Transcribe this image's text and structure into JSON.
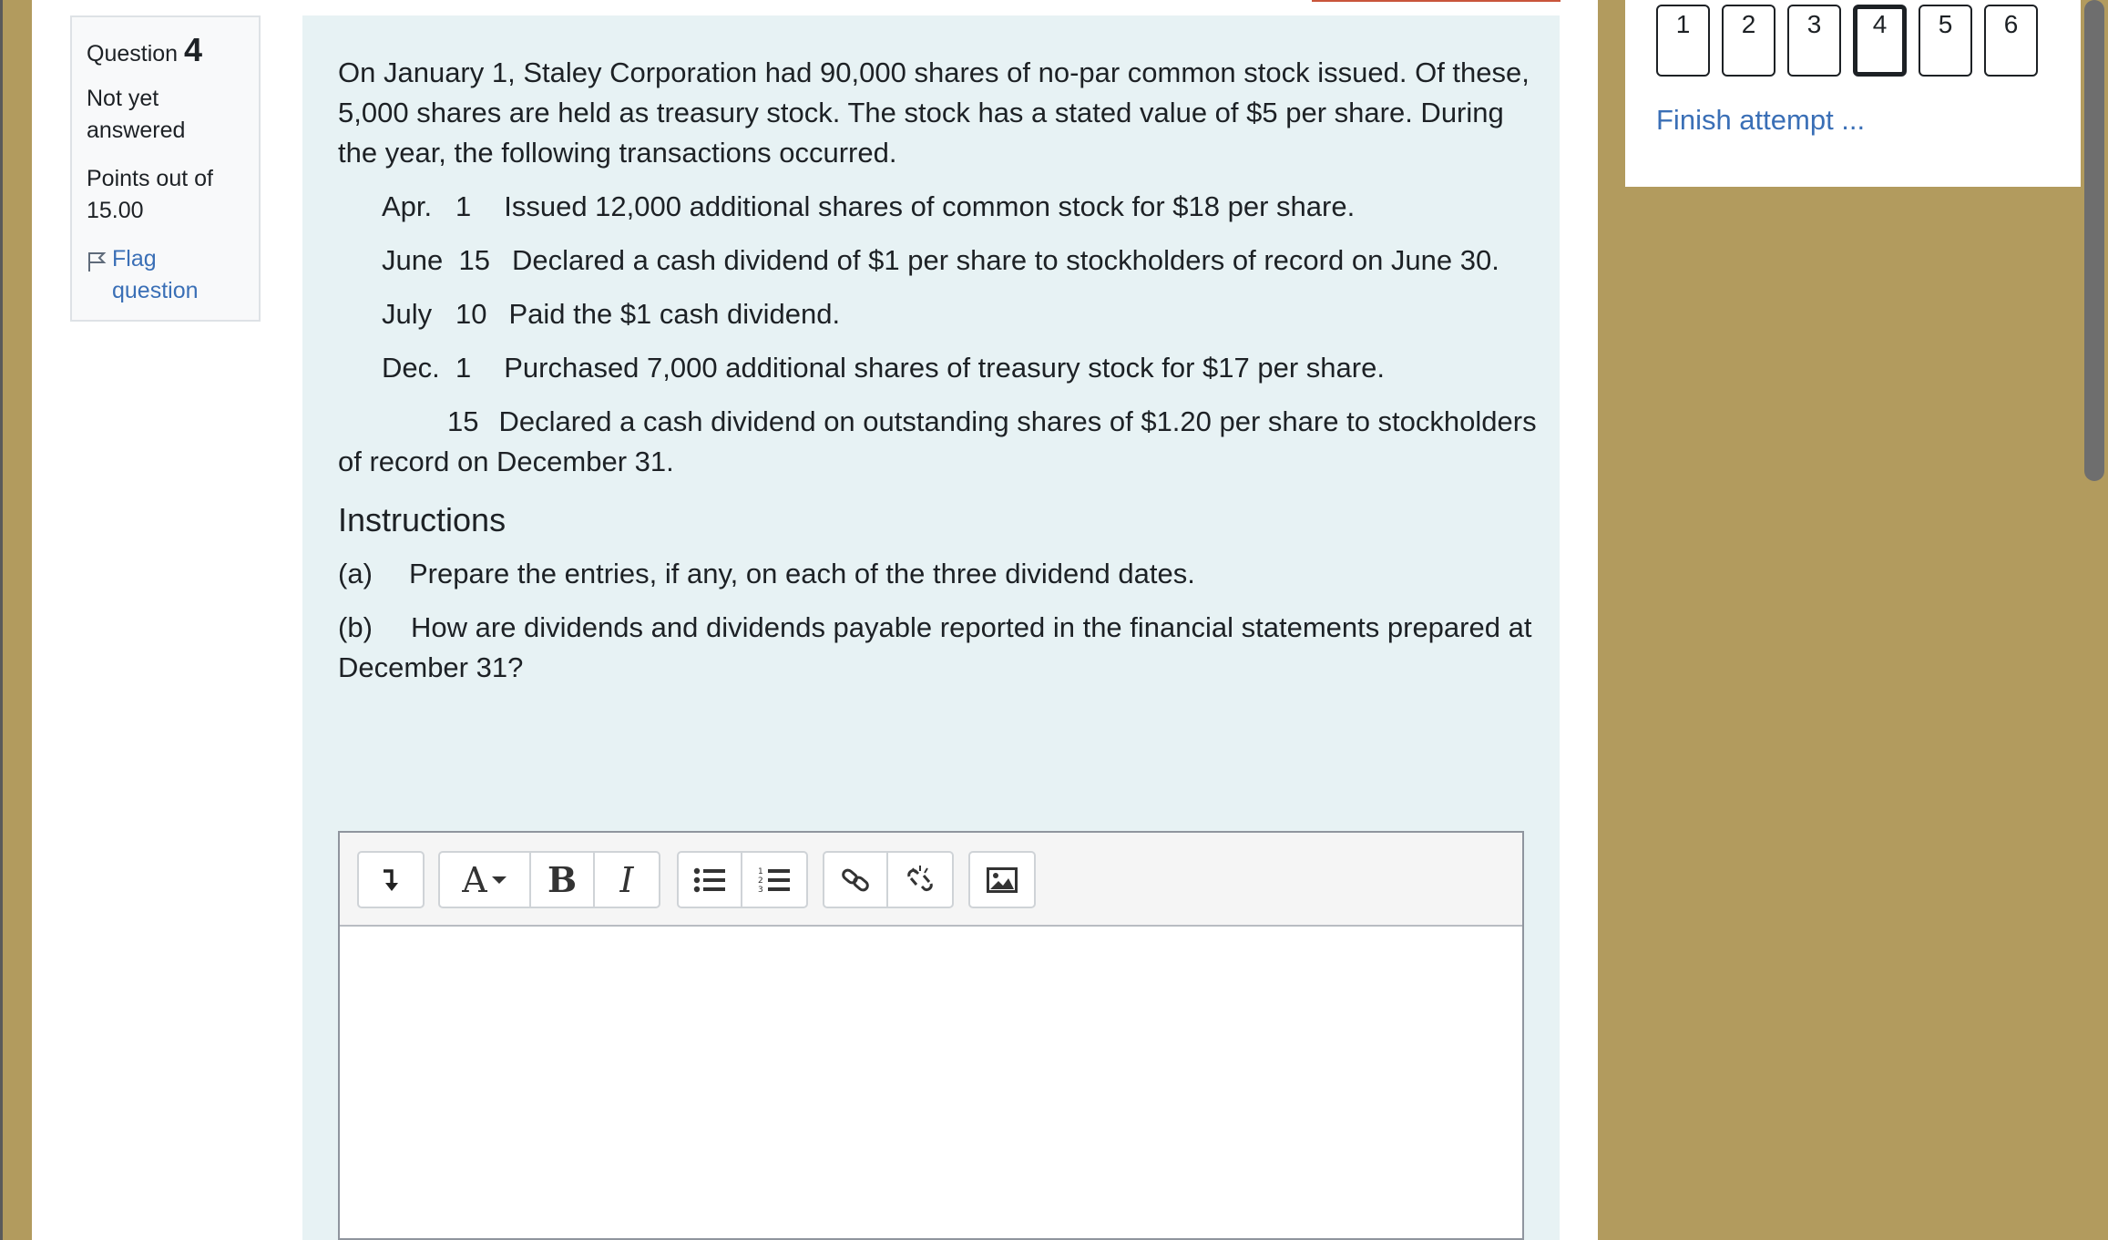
{
  "info": {
    "question_label": "Question",
    "question_number": "4",
    "state": "Not yet answered",
    "grade": "Points out of 15.00",
    "flag_label": "Flag question"
  },
  "question": {
    "intro": "On January 1, Staley Corporation had 90,000 shares of no-par common stock issued. Of these, 5,000 shares are held as treasury stock. The stock has a stated value of $5 per share. During the year, the following transactions occurred.",
    "transactions": [
      {
        "date": "Apr.   1",
        "text": "Issued 12,000 additional shares of common stock for $18 per share."
      },
      {
        "date": "June  15",
        "text": "Declared a cash dividend of $1 per share to stockholders of record on June 30."
      },
      {
        "date": "July   10",
        "text": "Paid the $1 cash dividend."
      },
      {
        "date": "Dec.  1",
        "text": "Purchased 7,000 additional shares of treasury stock for $17 per share."
      },
      {
        "date": "15",
        "text": "Declared a cash dividend on outstanding shares of $1.20 per share to stockholders of record on December 31."
      }
    ],
    "instructions_heading": "Instructions",
    "instructions": [
      {
        "label": "(a)",
        "text": "Prepare the entries, if any, on each of the three dividend dates."
      },
      {
        "label": "(b)",
        "text": "How are dividends and dividends payable reported in the financial statements prepared at December 31?"
      }
    ]
  },
  "editor": {
    "toolbar_icons": [
      "expand-toolbar-icon",
      "font-style-icon",
      "bold-icon",
      "italic-icon",
      "unordered-list-icon",
      "ordered-list-icon",
      "link-icon",
      "unlink-icon",
      "insert-image-icon"
    ],
    "bold_glyph": "B",
    "italic_glyph": "I",
    "font_glyph": "A",
    "content": ""
  },
  "nav": {
    "question_buttons": [
      "1",
      "2",
      "3",
      "4",
      "5",
      "6"
    ],
    "current": "4",
    "finish_label": "Finish attempt ..."
  }
}
